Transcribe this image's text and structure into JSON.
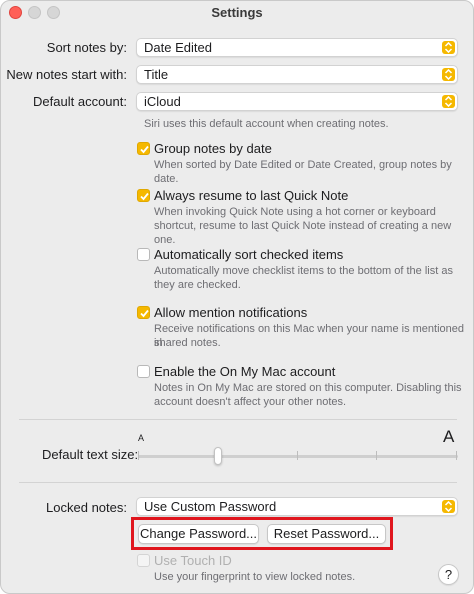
{
  "window": {
    "title": "Settings"
  },
  "settings": {
    "sort": {
      "label": "Sort notes by:",
      "value": "Date Edited"
    },
    "new_notes": {
      "label": "New notes start with:",
      "value": "Title"
    },
    "default_account": {
      "label": "Default account:",
      "value": "iCloud",
      "hint": "Siri uses this default account when creating notes."
    },
    "options": [
      {
        "label": "Group notes by date",
        "checked": true,
        "hint": [
          "When sorted by Date Edited or Date Created, group notes by date."
        ]
      },
      {
        "label": "Always resume to last Quick Note",
        "checked": true,
        "hint": [
          "When invoking Quick Note using a hot corner or keyboard",
          "shortcut, resume to last Quick Note instead of creating a new one."
        ]
      },
      {
        "label": "Automatically sort checked items",
        "checked": false,
        "hint": [
          "Automatically move checklist items to the bottom of the list as",
          "they are checked."
        ]
      },
      {
        "label": "Allow mention notifications",
        "checked": true,
        "hint": [
          "Receive notifications on this Mac when your name is mentioned in",
          "shared notes."
        ]
      },
      {
        "label": "Enable the On My Mac account",
        "checked": false,
        "hint": [
          "Notes in On My Mac are stored on this computer. Disabling this",
          "account doesn't affect your other notes."
        ]
      }
    ],
    "text_size": {
      "label": "Default text size:",
      "small": "A",
      "large": "A",
      "level": 0.25
    },
    "locked": {
      "label": "Locked notes:",
      "value": "Use Custom Password",
      "change_button": "Change Password...",
      "reset_button": "Reset Password...",
      "touch_id": {
        "label": "Use Touch ID",
        "checked": false,
        "enabled": false,
        "hint": "Use your fingerprint to view locked notes."
      }
    },
    "help": "?"
  },
  "colors": {
    "accent": "#f5b800",
    "highlight": "#e0161e"
  }
}
